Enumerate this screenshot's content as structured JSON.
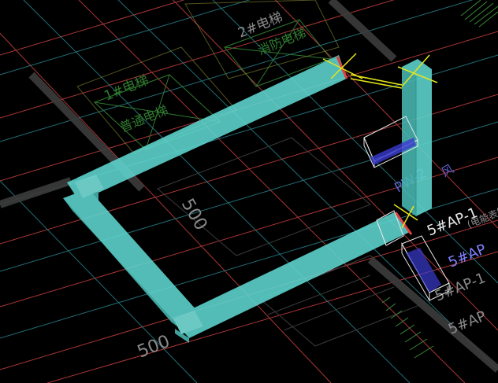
{
  "app": {
    "view": "3D isometric CAD viewport"
  },
  "colors": {
    "background": "#000000",
    "duct": "#5fd6d0",
    "duct_edge": "#3aa9a4",
    "red_line": "#c94040",
    "cyan_line": "#2a8a95",
    "grey_wall": "#3c3c3c",
    "green_text": "#2f7a2f",
    "white_text": "#e6e6e6",
    "blue_text": "#8080ff",
    "yellow_mark": "#e6e619",
    "green_hatch": "#3a8a3a"
  },
  "labels": {
    "elevator1": "1#电梯",
    "elevator1_sub": "普通电梯",
    "elevator2": "2#电梯",
    "elevator2_sub": "消防电梯",
    "dim_500_a": "500",
    "dim_500_b": "500",
    "pw2": "PW-2",
    "feng": "风",
    "ap1": "5#AP-1",
    "ap1_sub": "(电能表箱)",
    "ap2": "5#AP",
    "ap3": "5#AP-1",
    "ap4": "5#AP"
  },
  "icons": [
    "cad-crosshair-icon"
  ]
}
